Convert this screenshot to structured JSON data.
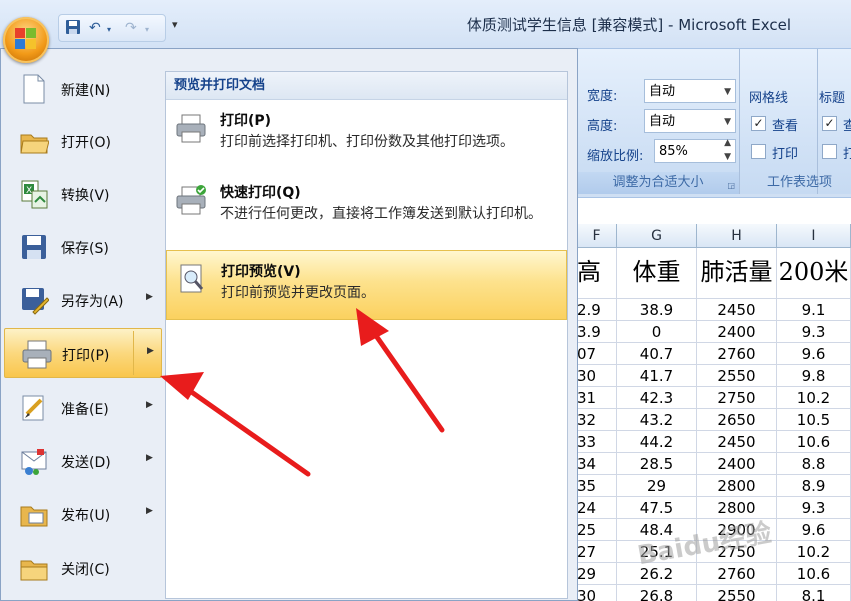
{
  "window": {
    "title": "体质测试学生信息  [兼容模式] - Microsoft Excel"
  },
  "ribbon": {
    "width_label": "宽度:",
    "width_value": "自动",
    "height_label": "高度:",
    "height_value": "自动",
    "scale_label": "缩放比例:",
    "scale_value": "85%",
    "scale_group_label": "调整为合适大小",
    "gridlines_label": "网格线",
    "gridlines_view": "查看",
    "gridlines_print": "打印",
    "sheet_options_label": "工作表选项",
    "headings_label": "标题",
    "headings_view_partial": "查",
    "headings_print_partial": "打"
  },
  "menu": {
    "left_items": [
      {
        "label": "新建(N)",
        "icon": "new-document-icon",
        "submenu": false
      },
      {
        "label": "打开(O)",
        "icon": "open-folder-icon",
        "submenu": false
      },
      {
        "label": "转换(V)",
        "icon": "convert-icon",
        "submenu": false
      },
      {
        "label": "保存(S)",
        "icon": "save-icon",
        "submenu": false
      },
      {
        "label": "另存为(A)",
        "icon": "save-as-icon",
        "submenu": true
      },
      {
        "label": "打印(P)",
        "icon": "printer-icon",
        "submenu": true,
        "active": true
      },
      {
        "label": "准备(E)",
        "icon": "prepare-icon",
        "submenu": true
      },
      {
        "label": "发送(D)",
        "icon": "send-icon",
        "submenu": true
      },
      {
        "label": "发布(U)",
        "icon": "publish-icon",
        "submenu": true
      },
      {
        "label": "关闭(C)",
        "icon": "close-folder-icon",
        "submenu": false
      }
    ],
    "right_header": "预览并打印文档",
    "print_items": [
      {
        "title": "打印(P)",
        "desc": "打印前选择打印机、打印份数及其他打印选项。",
        "icon": "printer-icon"
      },
      {
        "title": "快速打印(Q)",
        "desc": "不进行任何更改，直接将工作簿发送到默认打印机。",
        "icon": "quick-print-icon"
      },
      {
        "title": "打印预览(V)",
        "desc": "打印前预览并更改页面。",
        "icon": "print-preview-icon",
        "active": true
      }
    ]
  },
  "sheet": {
    "columns": [
      "F",
      "G",
      "H",
      "I"
    ],
    "headers": [
      "高",
      "体重",
      "肺活量",
      "200米"
    ],
    "rows": [
      [
        "2.9",
        "38.9",
        "2450",
        "9.1"
      ],
      [
        "3.9",
        "0",
        "2400",
        "9.3"
      ],
      [
        "07",
        "40.7",
        "2760",
        "9.6"
      ],
      [
        "30",
        "41.7",
        "2550",
        "9.8"
      ],
      [
        "31",
        "42.3",
        "2750",
        "10.2"
      ],
      [
        "32",
        "43.2",
        "2650",
        "10.5"
      ],
      [
        "33",
        "44.2",
        "2450",
        "10.6"
      ],
      [
        "34",
        "28.5",
        "2400",
        "8.8"
      ],
      [
        "35",
        "29",
        "2800",
        "8.9"
      ],
      [
        "24",
        "47.5",
        "2800",
        "9.3"
      ],
      [
        "25",
        "48.4",
        "2900",
        "9.6"
      ],
      [
        "27",
        "25.1",
        "2750",
        "10.2"
      ],
      [
        "29",
        "26.2",
        "2760",
        "10.6"
      ],
      [
        "30",
        "26.8",
        "2550",
        "8.1"
      ]
    ]
  },
  "watermark": "Baidu经验"
}
